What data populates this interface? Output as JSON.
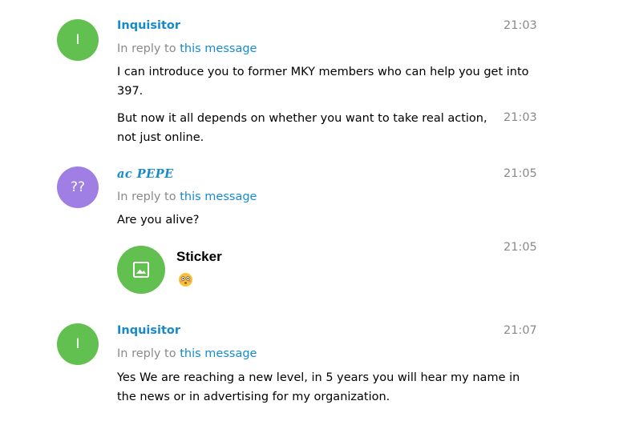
{
  "messages": [
    {
      "avatar_initial": "I",
      "avatar_color": "#61c04f",
      "author": "Inquisitor",
      "time": "21:03",
      "reply_prefix": "In reply to",
      "reply_link": "this message",
      "text": "I can introduce you to former MKY members who can help you get into 397."
    },
    {
      "time": "21:03",
      "text": "But now it all depends on whether you want to take real action, not just online."
    },
    {
      "avatar_initial": "??",
      "avatar_color": "#9f7fe3",
      "author": "ac PEPE",
      "time": "21:05",
      "reply_prefix": "In reply to",
      "reply_link": "this message",
      "text": "Are you alive?"
    },
    {
      "time": "21:05",
      "sticker_title": "Sticker",
      "sticker_icon": "image-icon",
      "emoji": "flushed-face-emoji"
    },
    {
      "avatar_initial": "I",
      "avatar_color": "#61c04f",
      "author": "Inquisitor",
      "time": "21:07",
      "reply_prefix": "In reply to",
      "reply_link": "this message",
      "text": "Yes We are reaching a new level, in 5 years you will hear my name in the news or in advertising for my organization."
    }
  ]
}
